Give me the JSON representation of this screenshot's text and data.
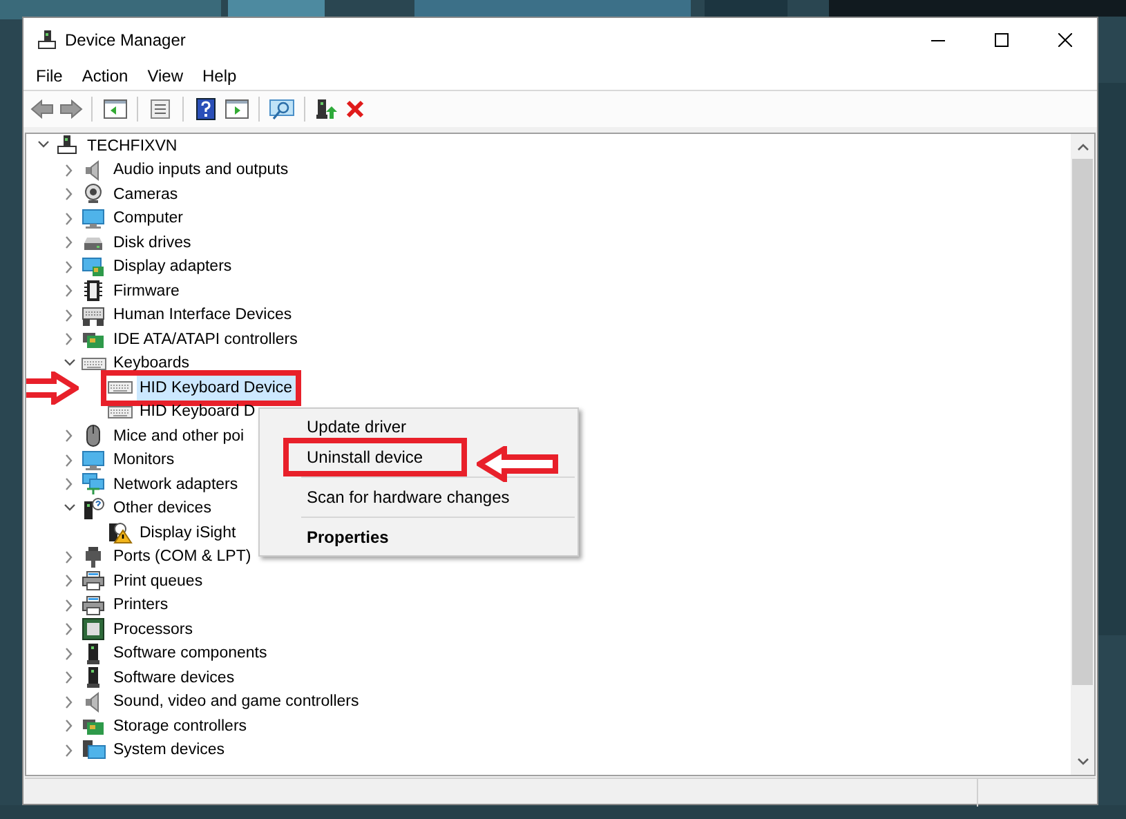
{
  "window": {
    "title": "Device Manager"
  },
  "menu": [
    "File",
    "Action",
    "View",
    "Help"
  ],
  "tree": {
    "label": "TECHFIXVN",
    "expanded": true,
    "kind": "computer",
    "children": [
      {
        "label": "Audio inputs and outputs",
        "kind": "speaker",
        "expanded": false
      },
      {
        "label": "Cameras",
        "kind": "camera",
        "expanded": false
      },
      {
        "label": "Computer",
        "kind": "monitor",
        "expanded": false
      },
      {
        "label": "Disk drives",
        "kind": "drive",
        "expanded": false
      },
      {
        "label": "Display adapters",
        "kind": "display",
        "expanded": false
      },
      {
        "label": "Firmware",
        "kind": "chip",
        "expanded": false
      },
      {
        "label": "Human Interface Devices",
        "kind": "hid",
        "expanded": false
      },
      {
        "label": "IDE ATA/ATAPI controllers",
        "kind": "card",
        "expanded": false
      },
      {
        "label": "Keyboards",
        "kind": "keyboard",
        "expanded": true,
        "children": [
          {
            "label": "HID Keyboard Device",
            "kind": "keyboard",
            "selected": true,
            "highlighted": true
          },
          {
            "label": "HID Keyboard D",
            "kind": "keyboard",
            "selected": false,
            "highlighted": false
          }
        ]
      },
      {
        "label": "Mice and other poi",
        "kind": "mouse",
        "expanded": false
      },
      {
        "label": "Monitors",
        "kind": "monitor",
        "expanded": false
      },
      {
        "label": "Network adapters",
        "kind": "network",
        "expanded": false
      },
      {
        "label": "Other devices",
        "kind": "unknown",
        "expanded": true,
        "children": [
          {
            "label": "Display iSight",
            "kind": "warning",
            "selected": false,
            "highlighted": false
          }
        ]
      },
      {
        "label": "Ports (COM & LPT)",
        "kind": "port",
        "expanded": false
      },
      {
        "label": "Print queues",
        "kind": "printer",
        "expanded": false
      },
      {
        "label": "Printers",
        "kind": "printer",
        "expanded": false
      },
      {
        "label": "Processors",
        "kind": "cpu",
        "expanded": false
      },
      {
        "label": "Software components",
        "kind": "tower",
        "expanded": false
      },
      {
        "label": "Software devices",
        "kind": "tower",
        "expanded": false
      },
      {
        "label": "Sound, video and game controllers",
        "kind": "speaker",
        "expanded": false
      },
      {
        "label": "Storage controllers",
        "kind": "card",
        "expanded": false
      },
      {
        "label": "System devices",
        "kind": "system",
        "expanded": false
      }
    ]
  },
  "context_menu": [
    {
      "kind": "item",
      "label": "Update driver",
      "bold": false,
      "highlighted": false
    },
    {
      "kind": "item",
      "label": "Uninstall device",
      "bold": false,
      "highlighted": true
    },
    {
      "kind": "separator"
    },
    {
      "kind": "item",
      "label": "Scan for hardware changes",
      "bold": false,
      "highlighted": false
    },
    {
      "kind": "separator"
    },
    {
      "kind": "item",
      "label": "Properties",
      "bold": true,
      "highlighted": false
    }
  ]
}
